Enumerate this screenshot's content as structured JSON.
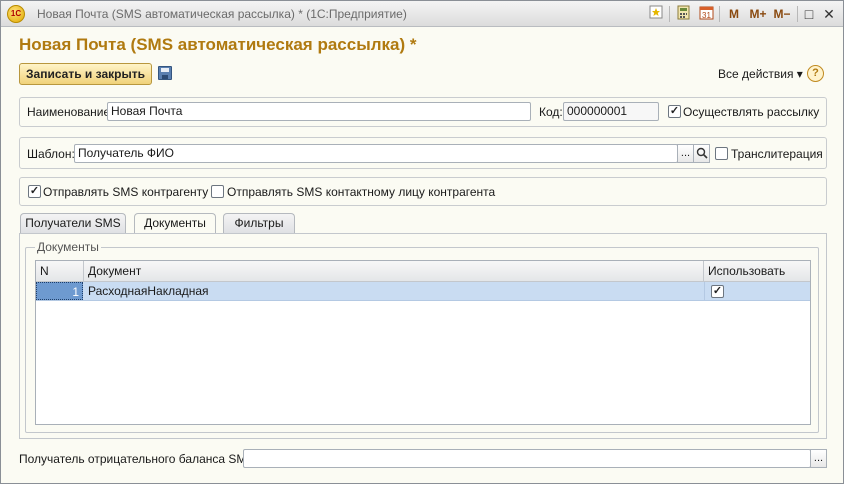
{
  "window": {
    "title": "Новая Почта (SMS автоматическая рассылка) *  (1С:Предприятие)",
    "app_icon_text": "1С",
    "toolbar": {
      "calc_icon": "calculator-icon",
      "calendar_icon": "calendar-icon",
      "calendar_text": "31",
      "m_label": "M",
      "mplus_label": "M+",
      "mminus_label": "M−",
      "restore_label": "□",
      "close_label": "✕"
    }
  },
  "form": {
    "header": "Новая Почта (SMS автоматическая рассылка) *",
    "save_close_label": "Записать и закрыть",
    "all_actions_label": "Все действия ▾",
    "help_label": "?",
    "name_label": "Наименование:",
    "name_value": "Новая Почта",
    "code_label": "Код:",
    "code_value": "000000001",
    "mailing_label": "Осуществлять рассылку",
    "mailing_checked": "✓",
    "template_label": "Шаблон:",
    "template_value": "Получатель ФИО",
    "select_button": "...",
    "search_button": "⌕",
    "translit_label": "Транслитерация",
    "send_counterparty_label": "Отправлять SMS контрагенту",
    "send_counterparty_checked": "✓",
    "send_contact_label": "Отправлять SMS контактному лицу контрагента",
    "negative_balance_label": "Получатель отрицательного баланса SMS:",
    "negative_balance_value": "",
    "negative_balance_button": "..."
  },
  "tabs": [
    {
      "label": "Получатели SMS"
    },
    {
      "label": "Документы"
    },
    {
      "label": "Фильтры"
    }
  ],
  "documents": {
    "legend": "Документы",
    "columns": [
      "N",
      "Документ",
      "Использовать"
    ],
    "rows": [
      {
        "n": "1",
        "document": "РасходнаяНакладная",
        "use": "✓"
      }
    ]
  }
}
